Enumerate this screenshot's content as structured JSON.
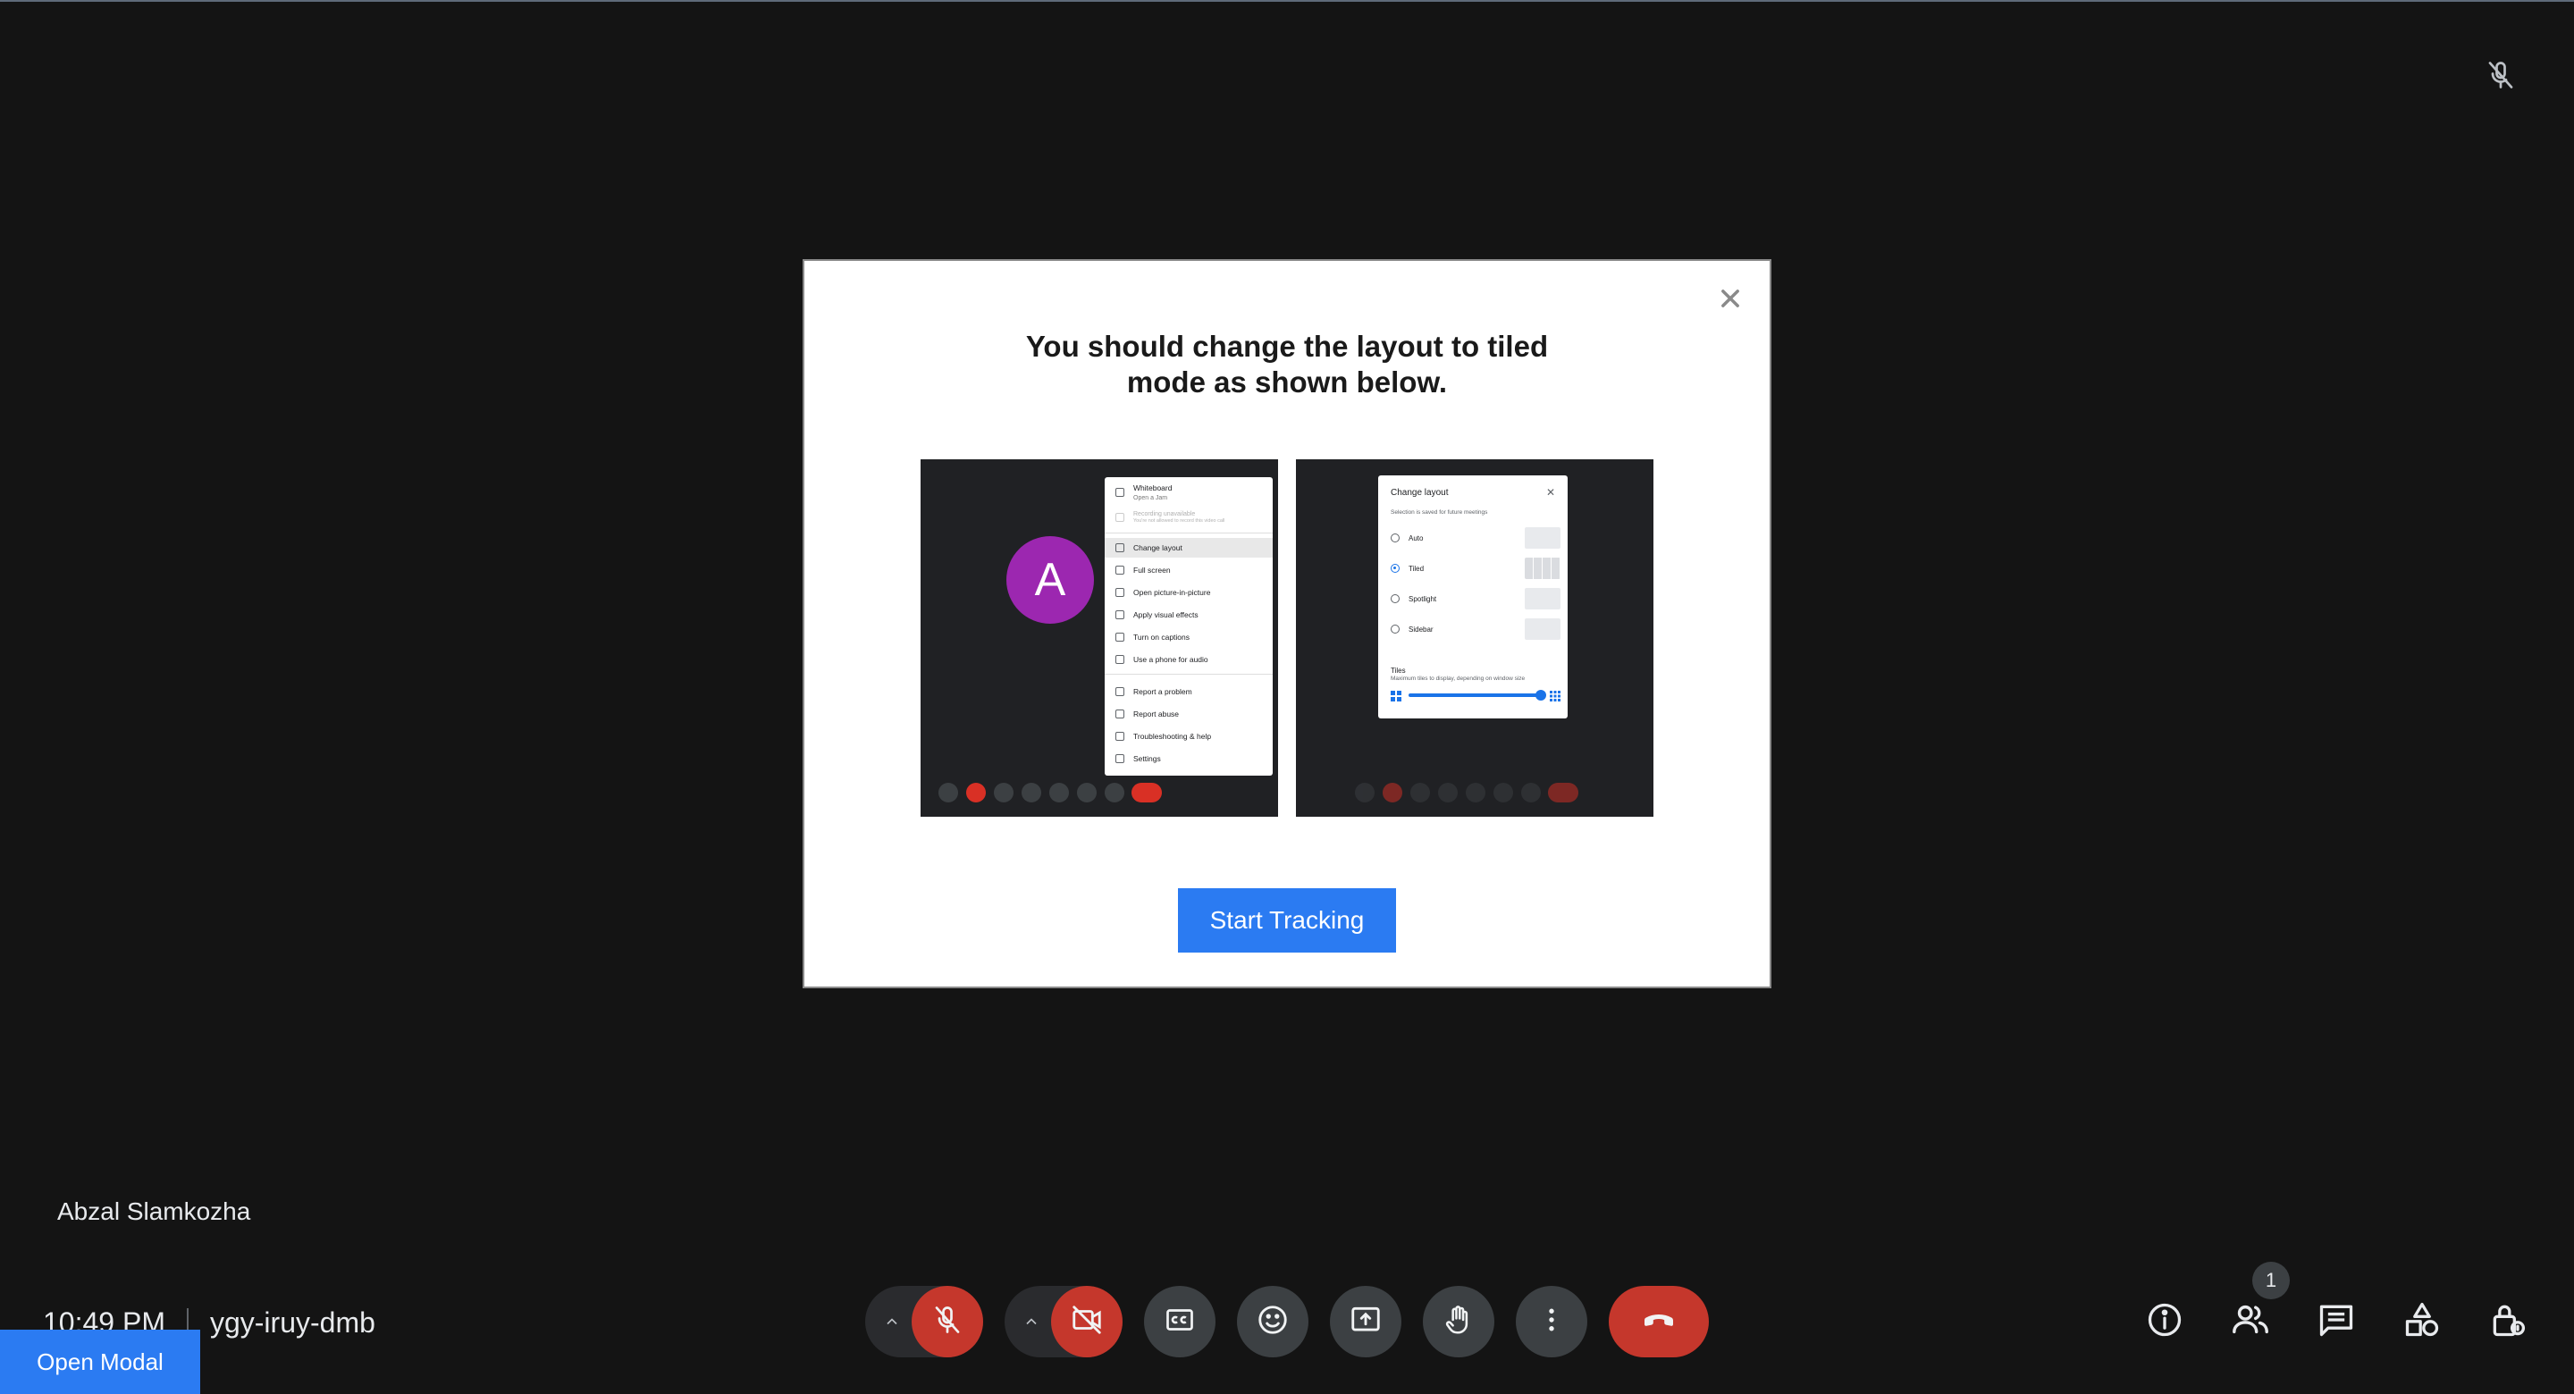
{
  "participant": {
    "name": "Abzal Slamkozha"
  },
  "meeting": {
    "time": "10:49 PM",
    "code": "ygy-iruy-dmb"
  },
  "open_modal_label": "Open Modal",
  "people_count": "1",
  "modal": {
    "title_line1": "You should change the layout to tiled",
    "title_line2": "mode as shown below.",
    "start_button": "Start Tracking",
    "close_symbol": "✕",
    "shot1": {
      "avatar_letter": "A",
      "menu": [
        {
          "label": "Whiteboard",
          "sub": "Open a Jam"
        },
        {
          "label": "Recording unavailable",
          "sub": "You're not allowed to record this video call"
        },
        {
          "label": "Change layout"
        },
        {
          "label": "Full screen"
        },
        {
          "label": "Open picture-in-picture"
        },
        {
          "label": "Apply visual effects"
        },
        {
          "label": "Turn on captions"
        },
        {
          "label": "Use a phone for audio"
        },
        {
          "label": "Report a problem"
        },
        {
          "label": "Report abuse"
        },
        {
          "label": "Troubleshooting & help"
        },
        {
          "label": "Settings"
        }
      ]
    },
    "shot2": {
      "title": "Change layout",
      "close": "✕",
      "subtitle": "Selection is saved for future meetings",
      "options": [
        "Auto",
        "Tiled",
        "Spotlight",
        "Sidebar"
      ],
      "selected": "Tiled",
      "tiles_label": "Tiles",
      "tiles_sub": "Maximum tiles to display, depending on window size"
    }
  },
  "icons": {
    "tile_mic": "mic-off-icon",
    "mic": "mic-off-icon",
    "camera": "videocam-off-icon",
    "captions": "closed-captions-icon",
    "emoji": "emoji-icon",
    "present": "present-screen-icon",
    "hand": "raise-hand-icon",
    "more": "more-options-icon",
    "end": "end-call-icon",
    "info": "info-icon",
    "people": "people-icon",
    "chat": "chat-icon",
    "activities": "activities-icon",
    "host": "host-controls-icon"
  },
  "colors": {
    "background": "#141414",
    "accent": "#2b7bf2",
    "danger": "#c5372c",
    "control": "#3c4043"
  }
}
